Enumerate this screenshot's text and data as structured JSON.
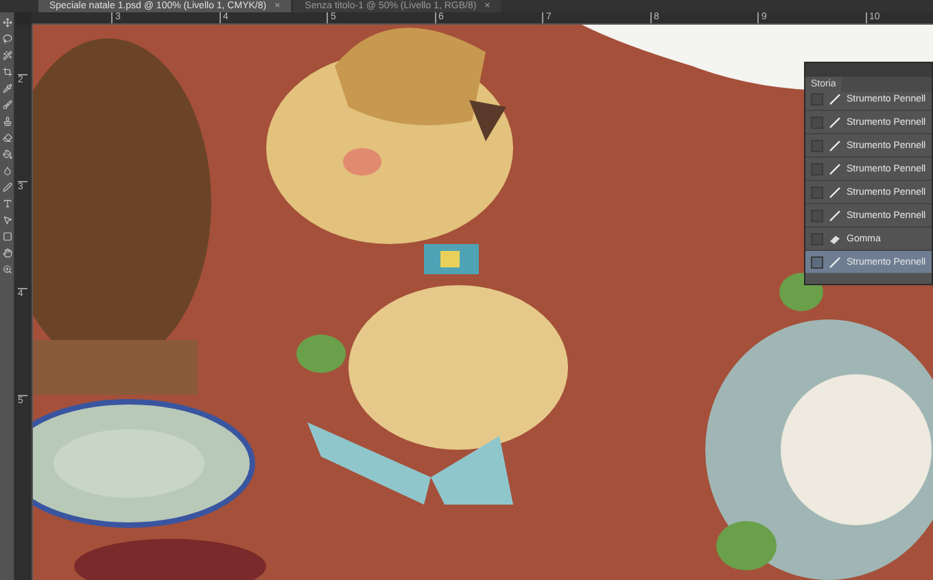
{
  "document_tabs": [
    {
      "label": "Speciale natale 1.psd @ 100% (Livello 1, CMYK/8)",
      "selected": true,
      "close": "×"
    },
    {
      "label": "Senza titolo-1 @ 50% (Livello 1, RGB/8)",
      "selected": false,
      "close": "×"
    }
  ],
  "ruler_horizontal": [
    "3",
    "4",
    "5",
    "6",
    "7",
    "8",
    "9",
    "10"
  ],
  "ruler_vertical": [
    "2",
    "3",
    "4",
    "5"
  ],
  "history_panel": {
    "tab": "Storia",
    "steps": [
      {
        "label": "Strumento Pennell",
        "kind": "brush",
        "selected": false
      },
      {
        "label": "Strumento Pennell",
        "kind": "brush",
        "selected": false
      },
      {
        "label": "Strumento Pennell",
        "kind": "brush",
        "selected": false
      },
      {
        "label": "Strumento Pennell",
        "kind": "brush",
        "selected": false
      },
      {
        "label": "Strumento Pennell",
        "kind": "brush",
        "selected": false
      },
      {
        "label": "Strumento Pennell",
        "kind": "brush",
        "selected": false
      },
      {
        "label": "Gomma",
        "kind": "eraser",
        "selected": false
      },
      {
        "label": "Strumento Pennell",
        "kind": "brush",
        "selected": true
      }
    ]
  }
}
